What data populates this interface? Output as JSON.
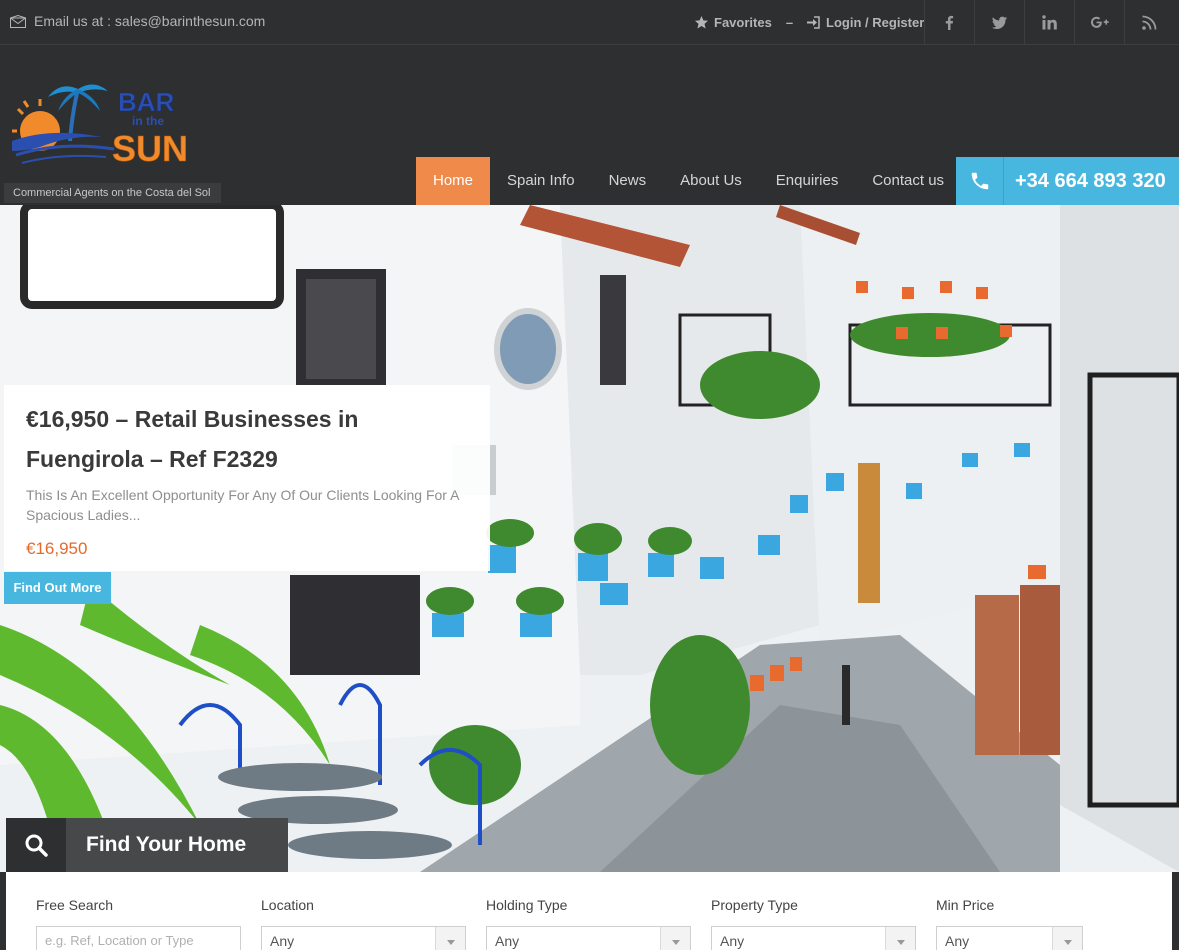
{
  "topbar": {
    "email": "Email us at : sales@barinthesun.com",
    "favorites": "Favorites",
    "separator": "–",
    "login": "Login / Register",
    "socials": [
      "facebook-icon",
      "twitter-icon",
      "linkedin-icon",
      "google-plus-icon",
      "rss-icon"
    ]
  },
  "header": {
    "logo": {
      "line1": "BAR",
      "line2": "in the",
      "line3": "SUN"
    },
    "tagline": "Commercial Agents on the Costa del Sol",
    "nav": [
      {
        "label": "Home",
        "active": true
      },
      {
        "label": "Spain Info"
      },
      {
        "label": "News"
      },
      {
        "label": "About Us"
      },
      {
        "label": "Enquiries"
      },
      {
        "label": "Contact us"
      }
    ],
    "phone": "+34 664 893 320"
  },
  "listing": {
    "title": "€16,950 – Retail Businesses in Fuengirola – Ref F2329",
    "description": "This Is An Excellent Opportunity For Any Of Our Clients Looking For A Spacious Ladies...",
    "price": "€16,950",
    "button": "Find Out More"
  },
  "search": {
    "title": "Find Your Home",
    "fields": [
      {
        "label": "Free Search",
        "placeholder": "e.g. Ref, Location or Type"
      },
      {
        "label": "Location",
        "value": "Any"
      },
      {
        "label": "Holding Type",
        "value": "Any"
      },
      {
        "label": "Property Type",
        "value": "Any"
      },
      {
        "label": "Min Price",
        "value": "Any"
      }
    ]
  },
  "colors": {
    "accent_orange": "#f08a4b",
    "accent_blue": "#47b7e0",
    "dark": "#2d2f31"
  }
}
